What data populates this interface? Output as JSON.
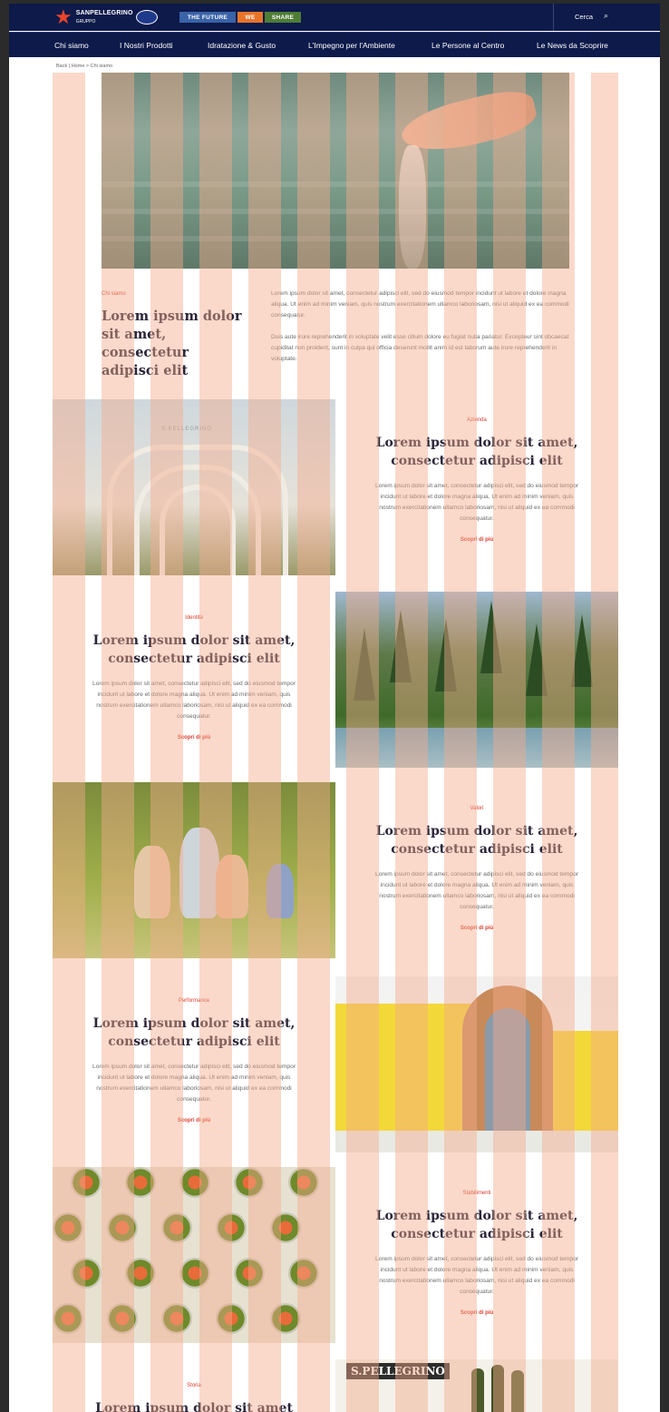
{
  "header": {
    "brand_line1": "SANPELLEGRINO",
    "brand_line2": "GRUPPO",
    "campaign": [
      "THE FUTURE",
      "WE",
      "SHARE"
    ],
    "search_label": "Cerca"
  },
  "nav": {
    "items": [
      {
        "label": "Chi siamo"
      },
      {
        "label": "I Nostri Prodotti"
      },
      {
        "label": "Idratazione & Gusto"
      },
      {
        "label": "L'Impegno per l'Ambiente"
      },
      {
        "label": "Le Persone al Centro"
      },
      {
        "label": "Le News da Scoprire"
      }
    ]
  },
  "breadcrumb": "Back | Home > Chi siamo",
  "intro": {
    "kicker": "Chi siamo",
    "title": "Lorem ipsum dolor sit amet, consectetur adipisci elit",
    "p1": "Lorem ipsum dolor sit amet, consectetur adipisci elit, sed do eiusmod tempor incidunt ut labore et dolore magna aliqua. Ut enim ad minim veniam, quis nostrum exercitationem ullamco laboriosam, nisi ut aliquid ex ea commodi consequatur.",
    "p2": "Duis aute irure reprehenderit in voluptate velit esse cillum dolore eu fugiat nulla pariatur. Excepteur sint obcaecat cupiditat non proident, sunt in culpa qui officia deserunt mollit anim id est laborum aute irure reprehenderit in voluptate."
  },
  "features": [
    {
      "kicker": "Azienda",
      "title": "Lorem ipsum dolor sit amet, consectetur adipisci elit",
      "desc": "Lorem ipsum dolor sit amet, consectetur adipisci elit, sed do eiusmod tempor incidunt ut labore et dolore magna aliqua. Ut enim ad minim veniam, quis nostrum exercitationem ullamco laboriosam, nisi ut aliquid ex ea commodi consequatur.",
      "more": "Scopri di più"
    },
    {
      "kicker": "Identità",
      "title": "Lorem ipsum dolor sit amet, consectetur adipisci elit",
      "desc": "Lorem ipsum dolor sit amet, consectetur adipisci elit, sed do eiusmod tempor incidunt ut labore et dolore magna aliqua. Ut enim ad minim veniam, quis nostrum exercitationem ullamco laboriosam, nisi ut aliquid ex ea commodi consequatur.",
      "more": "Scopri di più"
    },
    {
      "kicker": "Valori",
      "title": "Lorem ipsum dolor sit amet, consectetur adipisci elit",
      "desc": "Lorem ipsum dolor sit amet, consectetur adipisci elit, sed do eiusmod tempor incidunt ut labore et dolore magna aliqua. Ut enim ad minim veniam, quis nostrum exercitationem ullamco laboriosam, nisi ut aliquid ex ea commodi consequatur.",
      "more": "Scopri di più"
    },
    {
      "kicker": "Performance",
      "title": "Lorem ipsum dolor sit amet, consectetur adipisci elit",
      "desc": "Lorem ipsum dolor sit amet, consectetur adipisci elit, sed do eiusmod tempor incidunt ut labore et dolore magna aliqua. Ut enim ad minim veniam, quis nostrum exercitationem ullamco laboriosam, nisi ut aliquid ex ea commodi consequatur.",
      "more": "Scopri di più"
    },
    {
      "kicker": "Stabilimenti",
      "title": "Lorem ipsum dolor sit amet, consectetur adipisci elit",
      "desc": "Lorem ipsum dolor sit amet, consectetur adipisci elit, sed do eiusmod tempor incidunt ut labore et dolore magna aliqua. Ut enim ad minim veniam, quis nostrum exercitationem ullamco laboriosam, nisi ut aliquid ex ea commodi consequatur.",
      "more": "Scopri di più"
    },
    {
      "kicker": "Storia",
      "title": "Lorem ipsum dolor sit amet"
    }
  ],
  "images": {
    "arch_sign": "S.PELLEGRINO",
    "poster_sign": "S.PELLEGRINO"
  },
  "colors": {
    "navy": "#0d1a4a",
    "accent_red": "#d83a2a",
    "stripe": "#f5aa8c"
  }
}
